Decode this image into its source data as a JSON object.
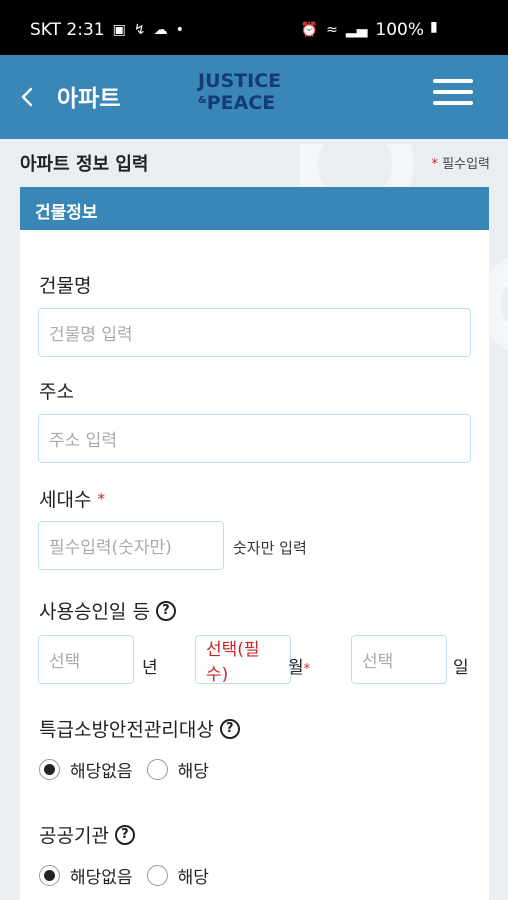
{
  "status": {
    "time": "SKT 2:31",
    "battery": "100%"
  },
  "appbar": {
    "title": "아파트",
    "logo_line1": "JUSTICE",
    "logo_line2": "PEACE",
    "logo_amp": "&"
  },
  "page": {
    "section_title": "아파트 정보 입력",
    "required_star": "*",
    "required_note": "필수입력"
  },
  "card": {
    "header": "건물정보",
    "building_name": {
      "label": "건물명",
      "placeholder": "건물명 입력"
    },
    "address": {
      "label": "주소",
      "placeholder": "주소 입력"
    },
    "households": {
      "label": "세대수",
      "star": "*",
      "placeholder": "필수입력(숫자만)",
      "hint": "숫자만 입력"
    },
    "approval_date": {
      "label": "사용승인일 등",
      "help": "?",
      "year_value": "선택",
      "year_suffix": "년",
      "month_value": "선택(필수)",
      "month_suffix": "월",
      "month_star": "*",
      "day_value": "선택",
      "day_suffix": "일"
    },
    "fire_safety": {
      "label": "특급소방안전관리대상",
      "help": "?",
      "options": [
        "해당없음",
        "해당"
      ],
      "selected": "해당없음"
    },
    "public_agency": {
      "label": "공공기관",
      "help": "?",
      "options": [
        "해당없음",
        "해당"
      ],
      "selected": "해당없음"
    }
  },
  "colors": {
    "primary": "#3a86b6",
    "logo": "#143b73",
    "required": "#c62828",
    "input_border": "#bfe0f1"
  }
}
